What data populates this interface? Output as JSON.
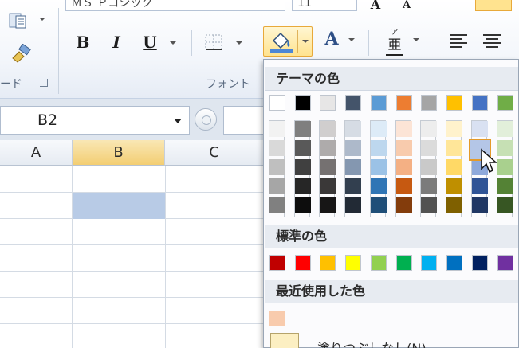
{
  "ribbon": {
    "font_name_value": "ＭＳ Ｐゴシック",
    "font_size_value": "11",
    "clipboard_label": "ード",
    "font_group_label": "フォント",
    "bold_label": "B",
    "italic_label": "I",
    "underline_label": "U",
    "font_color_label": "A",
    "grow_font_label": "A",
    "shrink_font_label": "A",
    "phonetic_label": "亜"
  },
  "namebox": {
    "value": "B2"
  },
  "sheet": {
    "columns": [
      "A",
      "B",
      "C"
    ],
    "selected_cell": "B2",
    "selected_fill": "#b8cbe6"
  },
  "color_menu": {
    "theme_title": "テーマの色",
    "standard_title": "標準の色",
    "recent_title": "最近使用した色",
    "no_fill_label": "塗りつぶしなし(N)",
    "theme_base": [
      "#ffffff",
      "#000000",
      "#e7e6e6",
      "#44546a",
      "#5b9bd5",
      "#ed7d31",
      "#a5a5a5",
      "#ffc000",
      "#4472c4",
      "#70ad47"
    ],
    "theme_shades": [
      [
        "#f2f2f2",
        "#d9d9d9",
        "#bfbfbf",
        "#a6a6a6",
        "#808080"
      ],
      [
        "#7f7f7f",
        "#595959",
        "#404040",
        "#262626",
        "#0d0d0d"
      ],
      [
        "#d0cece",
        "#aeabab",
        "#757171",
        "#3a3838",
        "#171616"
      ],
      [
        "#d6dce4",
        "#adb9ca",
        "#8497b0",
        "#323f4f",
        "#222a35"
      ],
      [
        "#ddebf7",
        "#bdd7ee",
        "#9bc2e6",
        "#2f75b5",
        "#1f4e78"
      ],
      [
        "#fce4d6",
        "#f8cbad",
        "#f4b084",
        "#c65911",
        "#833c0c"
      ],
      [
        "#ededed",
        "#dbdbdb",
        "#c9c9c9",
        "#7b7b7b",
        "#525252"
      ],
      [
        "#fff2cc",
        "#ffe699",
        "#ffd966",
        "#bf8f00",
        "#7f6000"
      ],
      [
        "#d9e1f2",
        "#b4c6e7",
        "#8ea9db",
        "#305496",
        "#203764"
      ],
      [
        "#e2efda",
        "#c6e0b4",
        "#a9d08e",
        "#548235",
        "#375623"
      ]
    ],
    "standard": [
      "#c00000",
      "#ff0000",
      "#ffc000",
      "#ffff00",
      "#92d050",
      "#00b050",
      "#00b0f0",
      "#0070c0",
      "#002060",
      "#7030a0"
    ],
    "recent": [
      "#f8cbad"
    ]
  },
  "icons": [
    "paste-icon",
    "format-painter-icon",
    "border-icon",
    "fill-color-icon",
    "font-color-icon",
    "phonetic-icon",
    "align-left-icon",
    "align-center-icon",
    "dialog-launcher-icon",
    "mouse-pointer-icon"
  ]
}
